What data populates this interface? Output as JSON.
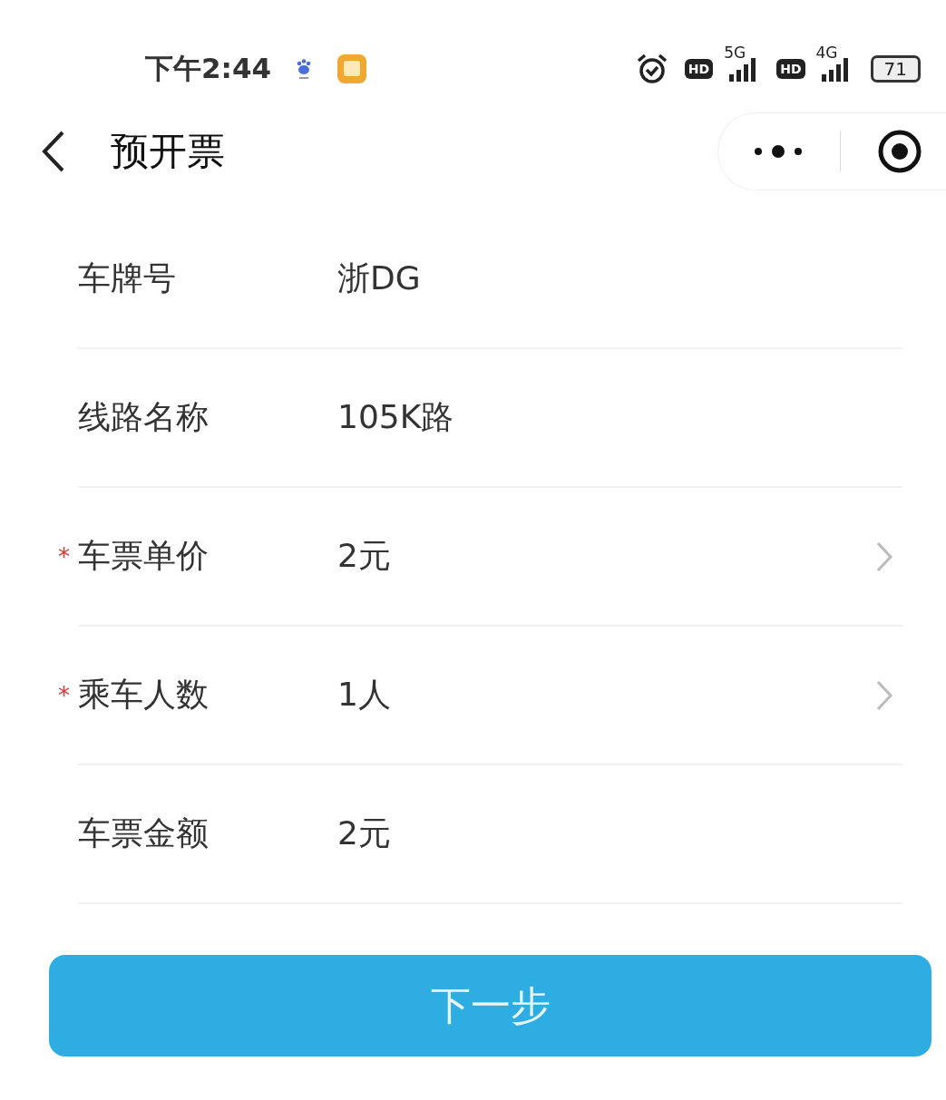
{
  "status_bar": {
    "time": "下午2:44",
    "hd_badges": [
      "HD",
      "HD"
    ],
    "networks": [
      "5G",
      "4G"
    ],
    "battery": "71"
  },
  "nav": {
    "title": "预开票"
  },
  "fields": [
    {
      "label": "车牌号",
      "value": "浙DG",
      "kind": "text"
    },
    {
      "label": "线路名称",
      "value": "105K路",
      "kind": "text"
    },
    {
      "label": "车票单价",
      "value": "2元",
      "required_mark": "*",
      "kind": "picker"
    },
    {
      "label": "乘车人数",
      "value": "1人",
      "required_mark": "*",
      "kind": "picker"
    },
    {
      "label": "车票金额",
      "value": "2元",
      "kind": "text"
    }
  ],
  "button": {
    "label": "下一步"
  }
}
